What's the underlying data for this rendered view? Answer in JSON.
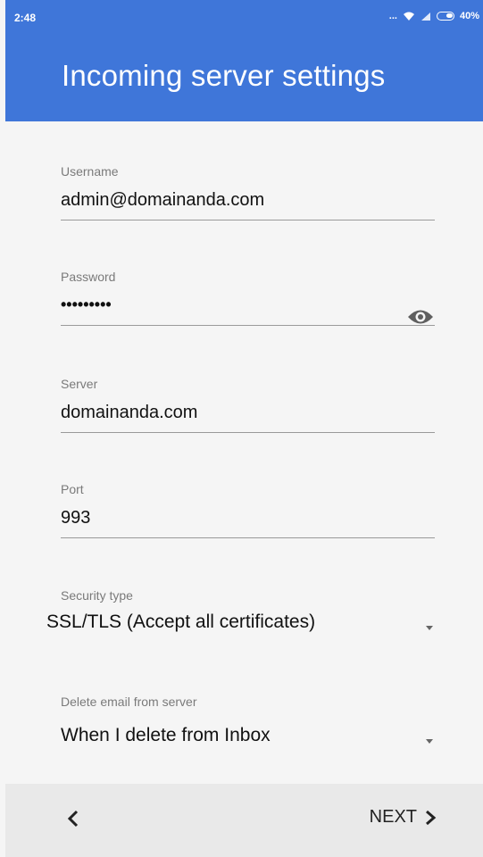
{
  "status_bar": {
    "time": "2:48",
    "dots": "...",
    "battery": "40%"
  },
  "header": {
    "title": "Incoming server settings"
  },
  "form": {
    "username": {
      "label": "Username",
      "value": "admin@domainanda.com"
    },
    "password": {
      "label": "Password",
      "value": "•••••••••"
    },
    "server": {
      "label": "Server",
      "value": "domainanda.com"
    },
    "port": {
      "label": "Port",
      "value": "993"
    },
    "security": {
      "label": "Security type",
      "value": "SSL/TLS (Accept all certificates)"
    },
    "delete": {
      "label": "Delete email from server",
      "value": "When I delete from Inbox"
    }
  },
  "footer": {
    "back": "<",
    "next": "NEXT"
  },
  "colors": {
    "header_bg": "#3f76d9",
    "page_bg": "#f5f5f5",
    "footer_bg": "#e9e9e9"
  },
  "icons": [
    "wifi-icon",
    "signal-icon",
    "battery-icon",
    "eye-icon",
    "dropdown-caret-icon",
    "chevron-left-icon",
    "chevron-right-icon"
  ]
}
